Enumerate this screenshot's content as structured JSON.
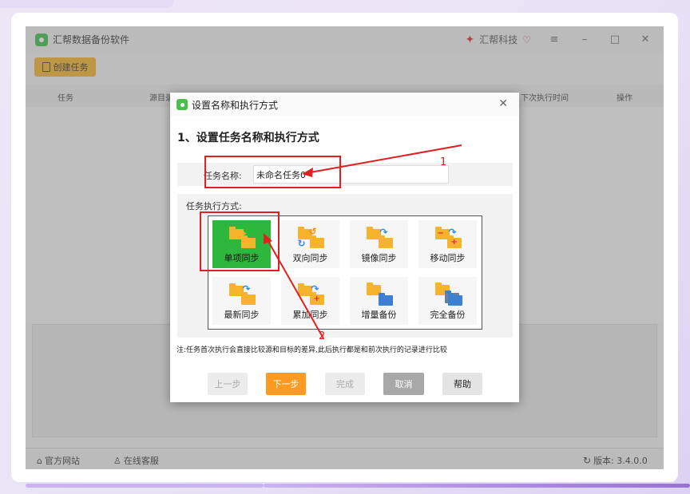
{
  "app": {
    "title": "汇帮数据备份软件",
    "brand": "汇帮科技",
    "toolbar": {
      "create_task": "创建任务"
    },
    "table_headers": [
      "任务",
      "源目录",
      "下次执行时间",
      "操作"
    ],
    "statusbar": {
      "website": "官方网站",
      "support": "在线客服",
      "version": "版本: 3.4.0.0"
    }
  },
  "dialog": {
    "title": "设置名称和执行方式",
    "step_heading": "1、设置任务名称和执行方式",
    "name_label": "任务名称:",
    "name_value": "未命名任务0",
    "mode_label": "任务执行方式:",
    "modes": [
      "单项同步",
      "双向同步",
      "镜像同步",
      "移动同步",
      "最新同步",
      "累加同步",
      "增量备份",
      "完全备份"
    ],
    "selected_mode": "单项同步",
    "note": "注:任务首次执行会直接比较源和目标的差异,此后执行都是和前次执行的记录进行比较",
    "buttons": {
      "prev": "上一步",
      "next": "下一步",
      "done": "完成",
      "cancel": "取消",
      "help": "帮助"
    }
  },
  "annotations": {
    "label1": "1",
    "label2": "2"
  },
  "colors": {
    "accent_orange": "#fd9a21",
    "selected_green": "#2db83d",
    "annotation_red": "#e02020",
    "create_yellow": "#f6b628"
  }
}
